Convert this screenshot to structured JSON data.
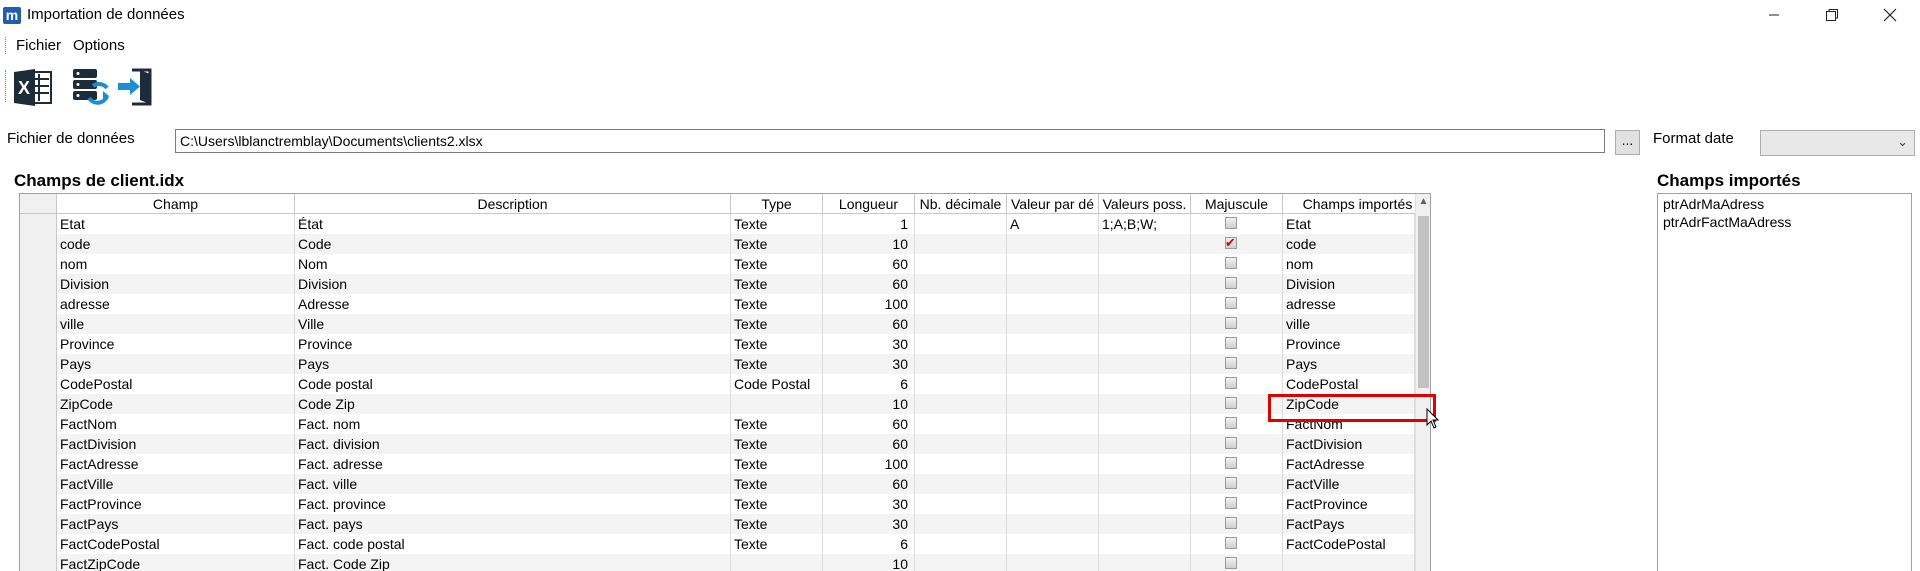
{
  "window": {
    "title": "Importation de données",
    "app_icon_letter": "m",
    "controls": [
      "minimize",
      "maximize",
      "close"
    ]
  },
  "menu": [
    "Fichier",
    "Options"
  ],
  "toolbar": [
    {
      "name": "excel-icon"
    },
    {
      "name": "database-sync-icon"
    },
    {
      "name": "import-icon"
    }
  ],
  "file": {
    "label": "Fichier de données",
    "value": "C:\\Users\\lblanctremblay\\Documents\\clients2.xlsx",
    "browse_label": "..."
  },
  "format_date": {
    "label": "Format date",
    "value": ""
  },
  "grid": {
    "title": "Champs de client.idx",
    "columns": [
      "Champ",
      "Description",
      "Type",
      "Longueur",
      "Nb. décimale",
      "Valeur par dé",
      "Valeurs poss.",
      "Majuscule",
      "Champs importés"
    ],
    "rows": [
      {
        "champ": "Etat",
        "description": "État",
        "type": "Texte",
        "longueur": "1",
        "decimale": "",
        "defaut": "A",
        "possibles": "1;A;B;W;",
        "majuscule": false,
        "importe": "Etat"
      },
      {
        "champ": "code",
        "description": "Code",
        "type": "Texte",
        "longueur": "10",
        "decimale": "",
        "defaut": "",
        "possibles": "",
        "majuscule": true,
        "importe": "code"
      },
      {
        "champ": "nom",
        "description": "Nom",
        "type": "Texte",
        "longueur": "60",
        "decimale": "",
        "defaut": "",
        "possibles": "",
        "majuscule": false,
        "importe": "nom"
      },
      {
        "champ": "Division",
        "description": "Division",
        "type": "Texte",
        "longueur": "60",
        "decimale": "",
        "defaut": "",
        "possibles": "",
        "majuscule": false,
        "importe": "Division"
      },
      {
        "champ": "adresse",
        "description": "Adresse",
        "type": "Texte",
        "longueur": "100",
        "decimale": "",
        "defaut": "",
        "possibles": "",
        "majuscule": false,
        "importe": "adresse"
      },
      {
        "champ": "ville",
        "description": "Ville",
        "type": "Texte",
        "longueur": "60",
        "decimale": "",
        "defaut": "",
        "possibles": "",
        "majuscule": false,
        "importe": "ville"
      },
      {
        "champ": "Province",
        "description": "Province",
        "type": "Texte",
        "longueur": "30",
        "decimale": "",
        "defaut": "",
        "possibles": "",
        "majuscule": false,
        "importe": "Province"
      },
      {
        "champ": "Pays",
        "description": "Pays",
        "type": "Texte",
        "longueur": "30",
        "decimale": "",
        "defaut": "",
        "possibles": "",
        "majuscule": false,
        "importe": "Pays"
      },
      {
        "champ": "CodePostal",
        "description": "Code postal",
        "type": "Code Postal",
        "longueur": "6",
        "decimale": "",
        "defaut": "",
        "possibles": "",
        "majuscule": false,
        "importe": "CodePostal"
      },
      {
        "champ": "ZipCode",
        "description": "Code Zip",
        "type": "",
        "longueur": "10",
        "decimale": "",
        "defaut": "",
        "possibles": "",
        "majuscule": false,
        "importe": "ZipCode"
      },
      {
        "champ": "FactNom",
        "description": "Fact. nom",
        "type": "Texte",
        "longueur": "60",
        "decimale": "",
        "defaut": "",
        "possibles": "",
        "majuscule": false,
        "importe": "FactNom"
      },
      {
        "champ": "FactDivision",
        "description": "Fact. division",
        "type": "Texte",
        "longueur": "60",
        "decimale": "",
        "defaut": "",
        "possibles": "",
        "majuscule": false,
        "importe": "FactDivision"
      },
      {
        "champ": "FactAdresse",
        "description": "Fact. adresse",
        "type": "Texte",
        "longueur": "100",
        "decimale": "",
        "defaut": "",
        "possibles": "",
        "majuscule": false,
        "importe": "FactAdresse"
      },
      {
        "champ": "FactVille",
        "description": "Fact. ville",
        "type": "Texte",
        "longueur": "60",
        "decimale": "",
        "defaut": "",
        "possibles": "",
        "majuscule": false,
        "importe": "FactVille"
      },
      {
        "champ": "FactProvince",
        "description": "Fact. province",
        "type": "Texte",
        "longueur": "30",
        "decimale": "",
        "defaut": "",
        "possibles": "",
        "majuscule": false,
        "importe": "FactProvince"
      },
      {
        "champ": "FactPays",
        "description": "Fact. pays",
        "type": "Texte",
        "longueur": "30",
        "decimale": "",
        "defaut": "",
        "possibles": "",
        "majuscule": false,
        "importe": "FactPays"
      },
      {
        "champ": "FactCodePostal",
        "description": "Fact. code postal",
        "type": "Texte",
        "longueur": "6",
        "decimale": "",
        "defaut": "",
        "possibles": "",
        "majuscule": false,
        "importe": "FactCodePostal"
      },
      {
        "champ": "FactZipCode",
        "description": "Fact. Code Zip",
        "type": "",
        "longueur": "10",
        "decimale": "",
        "defaut": "",
        "possibles": "",
        "majuscule": false,
        "importe": ""
      }
    ]
  },
  "imported": {
    "title": "Champs importés",
    "items": [
      "ptrAdrMaAdress",
      "ptrAdrFactMaAdress"
    ]
  },
  "colors": {
    "highlight": "#e00000",
    "checkmark": "#d00000",
    "app_icon": "#1f5fae"
  }
}
